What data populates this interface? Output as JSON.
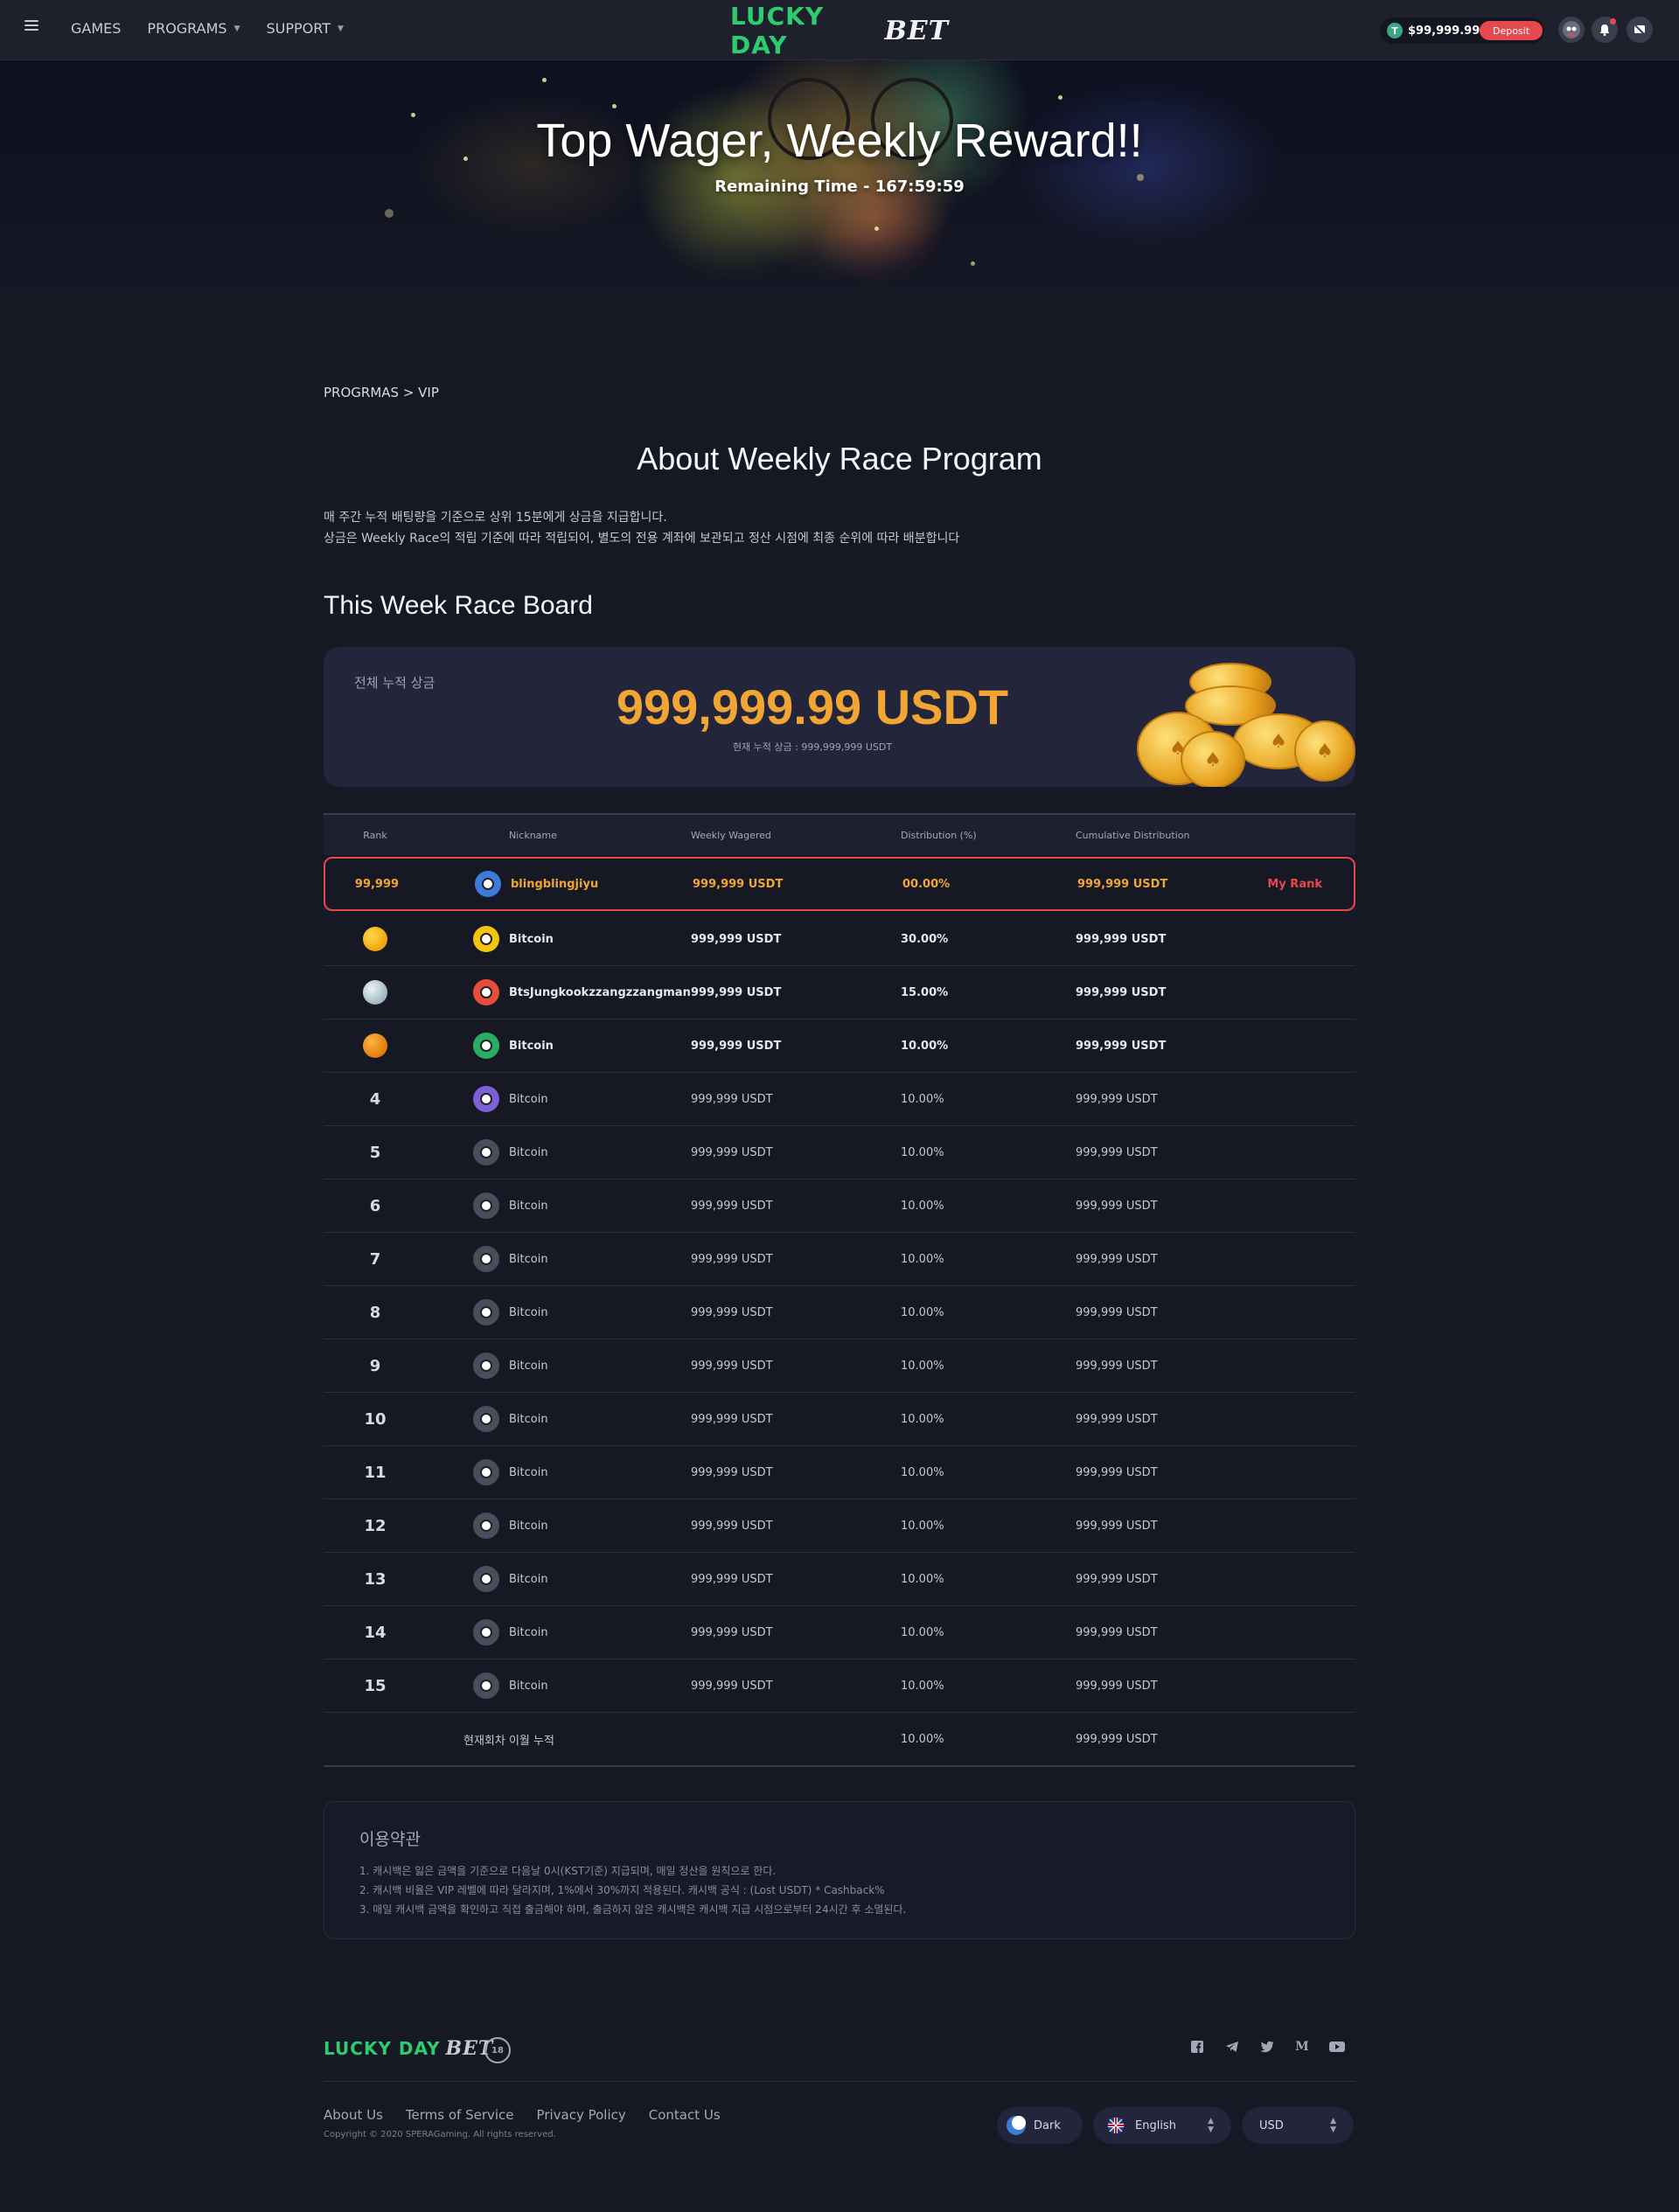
{
  "header": {
    "nav": [
      {
        "label": "GAMES"
      },
      {
        "label": "PROGRAMS"
      },
      {
        "label": "SUPPORT"
      }
    ],
    "logo_lucky": "LUCKY DAY",
    "logo_bet": "BET",
    "balance": "$99,999.99",
    "deposit_label": "Deposit",
    "icons": [
      "menu-icon",
      "tether-icon",
      "avatar",
      "bell-icon",
      "chat-icon"
    ]
  },
  "hero": {
    "title": "Top Wager, Weekly Reward!!",
    "subtitle": "Remaining Time - 167:59:59"
  },
  "breadcrumb": "PROGRMAS > VIP",
  "about": {
    "title": "About Weekly Race Program",
    "lines": [
      "매 주간 누적 배팅량을 기준으로 상위 15분에게 상금을 지급합니다.",
      "상금은 Weekly Race의 적립 기준에 따라 적립되어, 별도의 전용 계좌에 보관되고 정산 시점에 최종 순위에 따라 배분합니다"
    ]
  },
  "race_board": {
    "title": "This Week Race Board",
    "prize_label": "전체 누적 상금",
    "prize_amount": "999,999.99 USDT",
    "prize_sub": "현재 누적 상금 : 999,999,999 USDT"
  },
  "table": {
    "headers": {
      "rank": "Rank",
      "nickname": "Nickname",
      "wagered": "Weekly Wagered",
      "distribution": "Distribution (%)",
      "cumulative": "Cumulative Distribution"
    },
    "my_row": {
      "rank": "99,999",
      "nickname": "blingblingjiyu",
      "wagered": "999,999 USDT",
      "distribution": "00.00%",
      "cumulative": "999,999 USDT",
      "tag": "My Rank"
    },
    "rows": [
      {
        "rank": "",
        "medal": "gold",
        "nickname": "Bitcoin",
        "wagered": "999,999 USDT",
        "distribution": "30.00%",
        "cumulative": "999,999 USDT"
      },
      {
        "rank": "",
        "medal": "silver",
        "nickname": "BtsJungkookzzangzzangman",
        "wagered": "999,999 USDT",
        "distribution": "15.00%",
        "cumulative": "999,999 USDT"
      },
      {
        "rank": "",
        "medal": "bronze",
        "nickname": "Bitcoin",
        "wagered": "999,999 USDT",
        "distribution": "10.00%",
        "cumulative": "999,999 USDT"
      },
      {
        "rank": "4",
        "nickname": "Bitcoin",
        "wagered": "999,999 USDT",
        "distribution": "10.00%",
        "cumulative": "999,999 USDT"
      },
      {
        "rank": "5",
        "nickname": "Bitcoin",
        "wagered": "999,999 USDT",
        "distribution": "10.00%",
        "cumulative": "999,999 USDT"
      },
      {
        "rank": "6",
        "nickname": "Bitcoin",
        "wagered": "999,999 USDT",
        "distribution": "10.00%",
        "cumulative": "999,999 USDT"
      },
      {
        "rank": "7",
        "nickname": "Bitcoin",
        "wagered": "999,999 USDT",
        "distribution": "10.00%",
        "cumulative": "999,999 USDT"
      },
      {
        "rank": "8",
        "nickname": "Bitcoin",
        "wagered": "999,999 USDT",
        "distribution": "10.00%",
        "cumulative": "999,999 USDT"
      },
      {
        "rank": "9",
        "nickname": "Bitcoin",
        "wagered": "999,999 USDT",
        "distribution": "10.00%",
        "cumulative": "999,999 USDT"
      },
      {
        "rank": "10",
        "nickname": "Bitcoin",
        "wagered": "999,999 USDT",
        "distribution": "10.00%",
        "cumulative": "999,999 USDT"
      },
      {
        "rank": "11",
        "nickname": "Bitcoin",
        "wagered": "999,999 USDT",
        "distribution": "10.00%",
        "cumulative": "999,999 USDT"
      },
      {
        "rank": "12",
        "nickname": "Bitcoin",
        "wagered": "999,999 USDT",
        "distribution": "10.00%",
        "cumulative": "999,999 USDT"
      },
      {
        "rank": "13",
        "nickname": "Bitcoin",
        "wagered": "999,999 USDT",
        "distribution": "10.00%",
        "cumulative": "999,999 USDT"
      },
      {
        "rank": "14",
        "nickname": "Bitcoin",
        "wagered": "999,999 USDT",
        "distribution": "10.00%",
        "cumulative": "999,999 USDT"
      },
      {
        "rank": "15",
        "nickname": "Bitcoin",
        "wagered": "999,999 USDT",
        "distribution": "10.00%",
        "cumulative": "999,999 USDT"
      }
    ],
    "total_row": {
      "label": "현재회차 이월 누적",
      "distribution": "10.00%",
      "cumulative": "999,999 USDT"
    }
  },
  "terms": {
    "title": "이용약관",
    "lines": [
      "1. 캐시백은 잃은 금액을 기준으로 다음날 0시(KST기준) 지급되며, 매일 정산을 원칙으로 한다.",
      "2. 캐시백 비율은 VIP 레벨에 따라 달라지며, 1%에서 30%까지 적용된다. 캐시백 공식 : (Lost USDT) * Cashback%",
      "3. 매일 캐시백 금액을 확인하고 직접 출금해야 하며, 출금하지 않은 캐시백은 캐시백 지급 시점으로부터 24시간 후 소멸된다."
    ]
  },
  "footer": {
    "logo_lucky": "LUCKY DAY",
    "logo_bet": "BET",
    "age": "18",
    "links": [
      "About Us",
      "Terms of Service",
      "Privacy Policy",
      "Contact Us"
    ],
    "copyright": "Copyright © 2020 SPERAGaming. All rights reserved.",
    "theme": "Dark",
    "language": "English",
    "currency": "USD",
    "socials": [
      "facebook-icon",
      "telegram-icon",
      "twitter-icon",
      "medium-icon",
      "youtube-icon"
    ]
  },
  "colors": {
    "accent_orange": "#f0a535",
    "brand_green": "#2ecc71",
    "alert_red": "#e5484d",
    "background": "#161824"
  }
}
